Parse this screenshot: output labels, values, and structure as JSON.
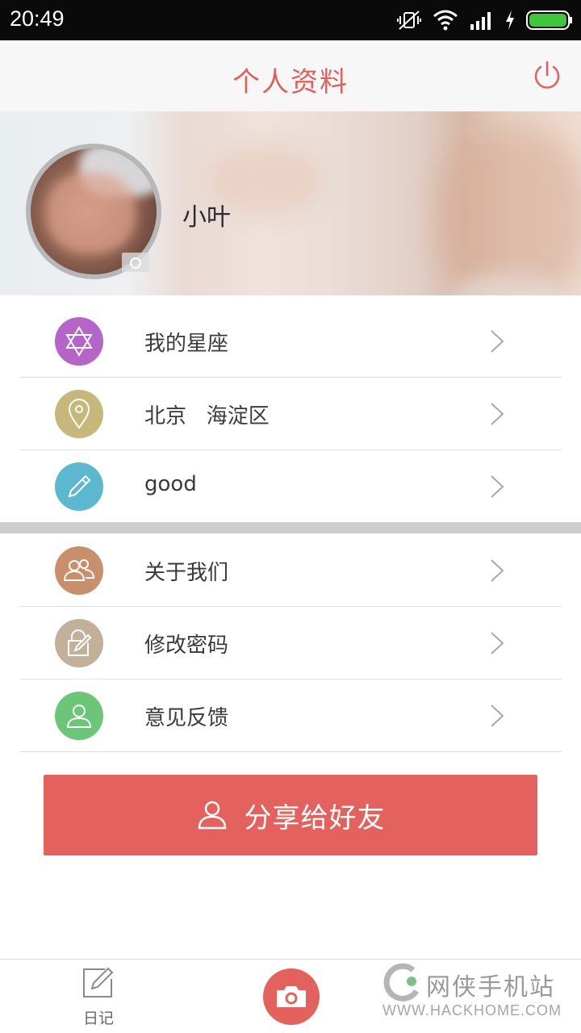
{
  "status_bar": {
    "time": "20:49",
    "icons": [
      "vibrate-off-icon",
      "wifi-icon",
      "signal-icon",
      "charging-icon",
      "battery-icon"
    ]
  },
  "header": {
    "title": "个人资料",
    "power_icon": "power-icon"
  },
  "profile": {
    "name": "小叶"
  },
  "menu_group_1": [
    {
      "label": "我的星座",
      "icon": "star-of-david-icon",
      "color": "#b565c7"
    },
    {
      "label": "北京   海淀区",
      "icon": "location-pin-icon",
      "color": "#c6b77a"
    },
    {
      "label": "good",
      "icon": "pencil-icon",
      "color": "#5bb8cf"
    }
  ],
  "menu_group_2": [
    {
      "label": "关于我们",
      "icon": "users-icon",
      "color": "#c98e6b"
    },
    {
      "label": "修改密码",
      "icon": "lock-edit-icon",
      "color": "#c2b09a"
    },
    {
      "label": "意见反馈",
      "icon": "user-icon",
      "color": "#6bc777"
    }
  ],
  "share_button": {
    "label": "分享给好友",
    "color": "#e3625d"
  },
  "bottom_nav": {
    "diary_label": "日记"
  },
  "watermark": {
    "text": "网侠手机站",
    "url": "WWW.HACKHOME.COM"
  },
  "colors": {
    "accent": "#e3625d",
    "status_bar": "#0a0a0a",
    "battery": "#3ec63e"
  }
}
